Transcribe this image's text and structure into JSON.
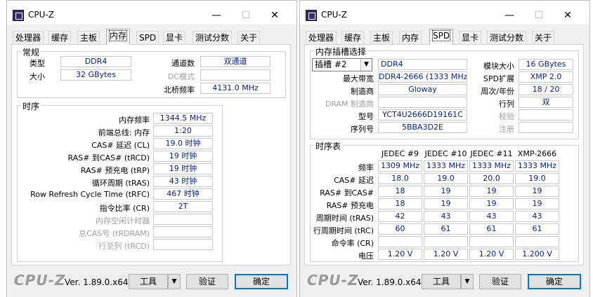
{
  "app": {
    "title": "CPU-Z",
    "brand": "CPU-Z",
    "version": "Ver. 1.89.0.x64",
    "tools": "工具",
    "validate": "验证",
    "ok": "确定",
    "dropdown_icon": "triangle-down",
    "min": "—",
    "max": "☐",
    "close": "✕"
  },
  "tabs": [
    "处理器",
    "缓存",
    "主板",
    "内存",
    "SPD",
    "显卡",
    "测试分数",
    "关于"
  ],
  "mem": {
    "general": {
      "title": "常规",
      "type_label": "类型",
      "type": "DDR4",
      "size_label": "大小",
      "size": "32 GBytes",
      "channel_label": "通道数",
      "channel": "双通道",
      "dc_label": "DC模式",
      "dc": "",
      "nb_label": "北桥频率",
      "nb": "4131.0 MHz"
    },
    "timing": {
      "title": "时序",
      "rows": [
        {
          "label": "内存频率",
          "value": "1344.5 MHz",
          "dis": false
        },
        {
          "label": "前端总线: 内存",
          "value": "1:20",
          "dis": false
        },
        {
          "label": "CAS# 延迟 (CL)",
          "value": "19.0 时钟",
          "dis": false
        },
        {
          "label": "RAS# 到CAS# (tRCD)",
          "value": "19 时钟",
          "dis": false
        },
        {
          "label": "RAS# 预充电 (tRP)",
          "value": "19 时钟",
          "dis": false
        },
        {
          "label": "循环周期 (tRAS)",
          "value": "43 时钟",
          "dis": false
        },
        {
          "label": "Row Refresh Cycle Time (tRFC)",
          "value": "467 时钟",
          "dis": false
        },
        {
          "label": "指令比率 (CR)",
          "value": "2T",
          "dis": false
        },
        {
          "label": "内存空闲计时器",
          "value": "",
          "dis": true
        },
        {
          "label": "总CAS号 (tRDRAM)",
          "value": "",
          "dis": true
        },
        {
          "label": "行至列 (tRCD)",
          "value": "",
          "dis": true
        }
      ]
    }
  },
  "spd": {
    "slot": {
      "title": "内存插槽选择",
      "selected": "插槽 #2",
      "type": "DDR4",
      "max_bw_label": "最大带宽",
      "max_bw": "DDR4-2666 (1333 MHz)",
      "maker_label": "制造商",
      "maker": "Gloway",
      "dram_label": "DRAM 制造商",
      "dram": "",
      "part_label": "型号",
      "part": "YCT4U2666D19161C",
      "serial_label": "序列号",
      "serial": "5BBA3D2E",
      "module_size_label": "模块大小",
      "module_size": "16 GBytes",
      "ext_label": "SPD扩展",
      "ext": "XMP 2.0",
      "week_label": "周次/年份",
      "week": "18 / 20",
      "rank_label": "行列",
      "rank": "双",
      "check_label": "校验",
      "check": "",
      "reg_label": "注册",
      "reg": ""
    },
    "table": {
      "title": "时序表",
      "headers": [
        "JEDEC #9",
        "JEDEC #10",
        "JEDEC #11",
        "XMP-2666"
      ],
      "rows": [
        {
          "label": "频率",
          "values": [
            "1309 MHz",
            "1333 MHz",
            "1333 MHz",
            "1333 MHz"
          ]
        },
        {
          "label": "CAS# 延迟",
          "values": [
            "18.0",
            "19.0",
            "20.0",
            "19.0"
          ]
        },
        {
          "label": "RAS# 到CAS#",
          "values": [
            "18",
            "19",
            "19",
            "19"
          ]
        },
        {
          "label": "RAS# 预充电",
          "values": [
            "18",
            "19",
            "19",
            "19"
          ]
        },
        {
          "label": "周期时间 (tRAS)",
          "values": [
            "42",
            "43",
            "43",
            "43"
          ]
        },
        {
          "label": "行周期时间 (tRC)",
          "values": [
            "60",
            "61",
            "61",
            "61"
          ]
        },
        {
          "label": "命令率 (CR)",
          "values": [
            "",
            "",
            "",
            ""
          ]
        },
        {
          "label": "电压",
          "values": [
            "1.20 V",
            "1.20 V",
            "1.20 V",
            "1.200 V"
          ]
        }
      ]
    }
  }
}
